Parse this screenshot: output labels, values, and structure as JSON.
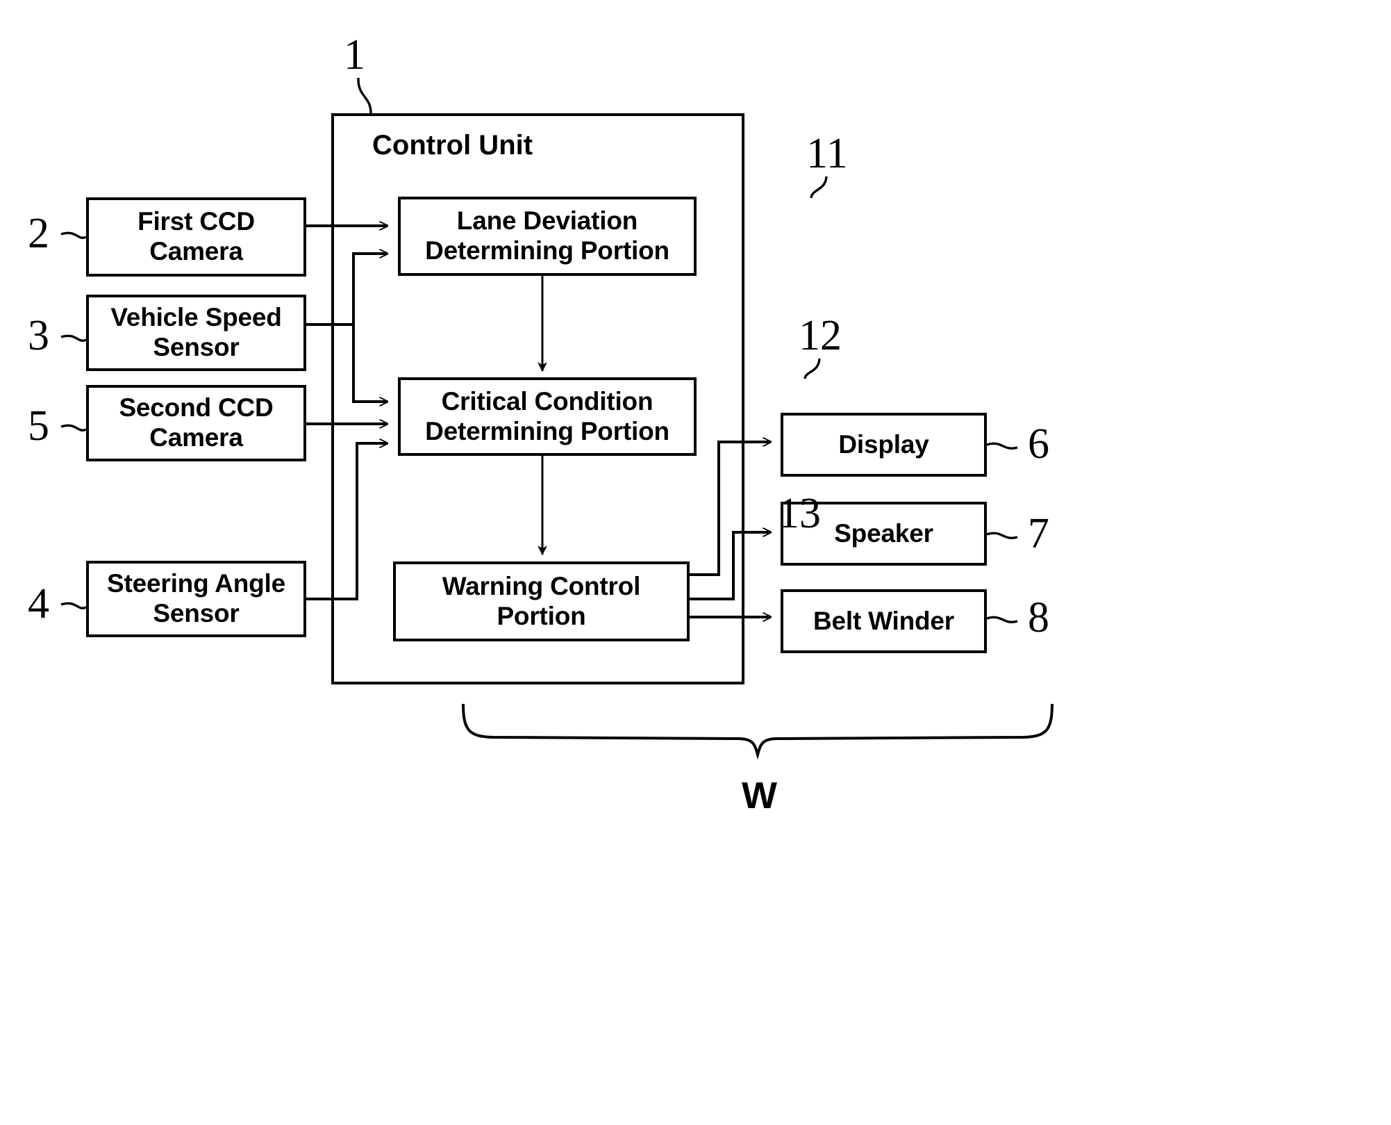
{
  "figure": {
    "type": "patent-block-diagram",
    "bracket_label": "W"
  },
  "control_unit": {
    "title": "Control Unit",
    "ref": "1"
  },
  "inputs": [
    {
      "id": "first-ccd-camera",
      "label": "First CCD\nCamera",
      "ref": "2"
    },
    {
      "id": "vehicle-speed-sensor",
      "label": "Vehicle Speed\nSensor",
      "ref": "3"
    },
    {
      "id": "second-ccd-camera",
      "label": "Second CCD\nCamera",
      "ref": "5"
    },
    {
      "id": "steering-angle-sensor",
      "label": "Steering Angle\nSensor",
      "ref": "4"
    }
  ],
  "portions": [
    {
      "id": "lane-deviation-determining-portion",
      "label": "Lane Deviation\nDetermining Portion",
      "ref": "11"
    },
    {
      "id": "critical-condition-determining-portion",
      "label": "Critical Condition\nDetermining Portion",
      "ref": "12"
    },
    {
      "id": "warning-control-portion",
      "label": "Warning Control\nPortion",
      "ref": "13"
    }
  ],
  "outputs": [
    {
      "id": "display",
      "label": "Display",
      "ref": "6"
    },
    {
      "id": "speaker",
      "label": "Speaker",
      "ref": "7"
    },
    {
      "id": "belt-winder",
      "label": "Belt Winder",
      "ref": "8"
    }
  ],
  "colors": {
    "line": "#000000",
    "background": "#ffffff",
    "text": "#000000"
  }
}
